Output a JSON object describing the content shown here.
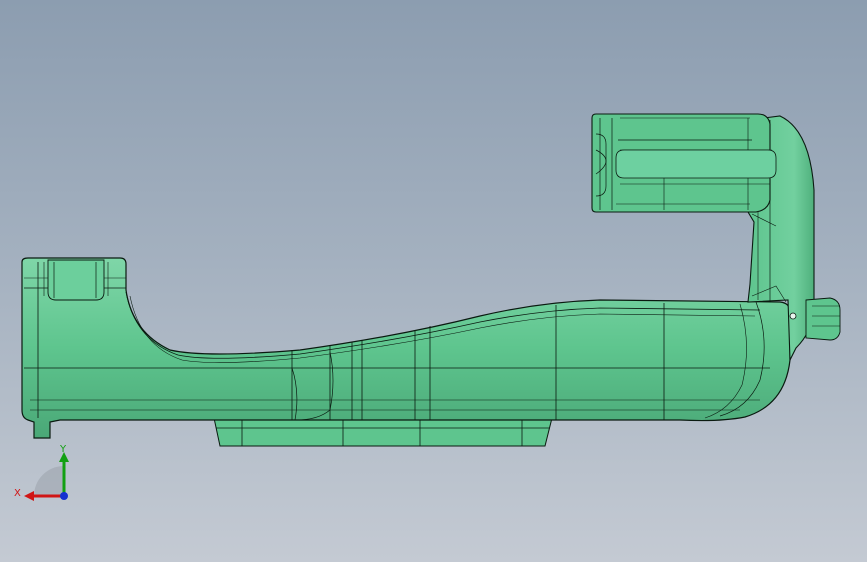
{
  "viewport": {
    "background_top": "#8c9db0",
    "background_bottom": "#c4cad3"
  },
  "model": {
    "fill_color": "#5ec58e",
    "fill_shadow": "#4fb07c",
    "fill_highlight": "#7fd6a8",
    "edge_color": "#0a1a10"
  },
  "triad": {
    "x_label": "X",
    "y_label": "Y",
    "x_color": "#d01515",
    "y_color": "#12a012",
    "z_color": "#1530d0"
  }
}
